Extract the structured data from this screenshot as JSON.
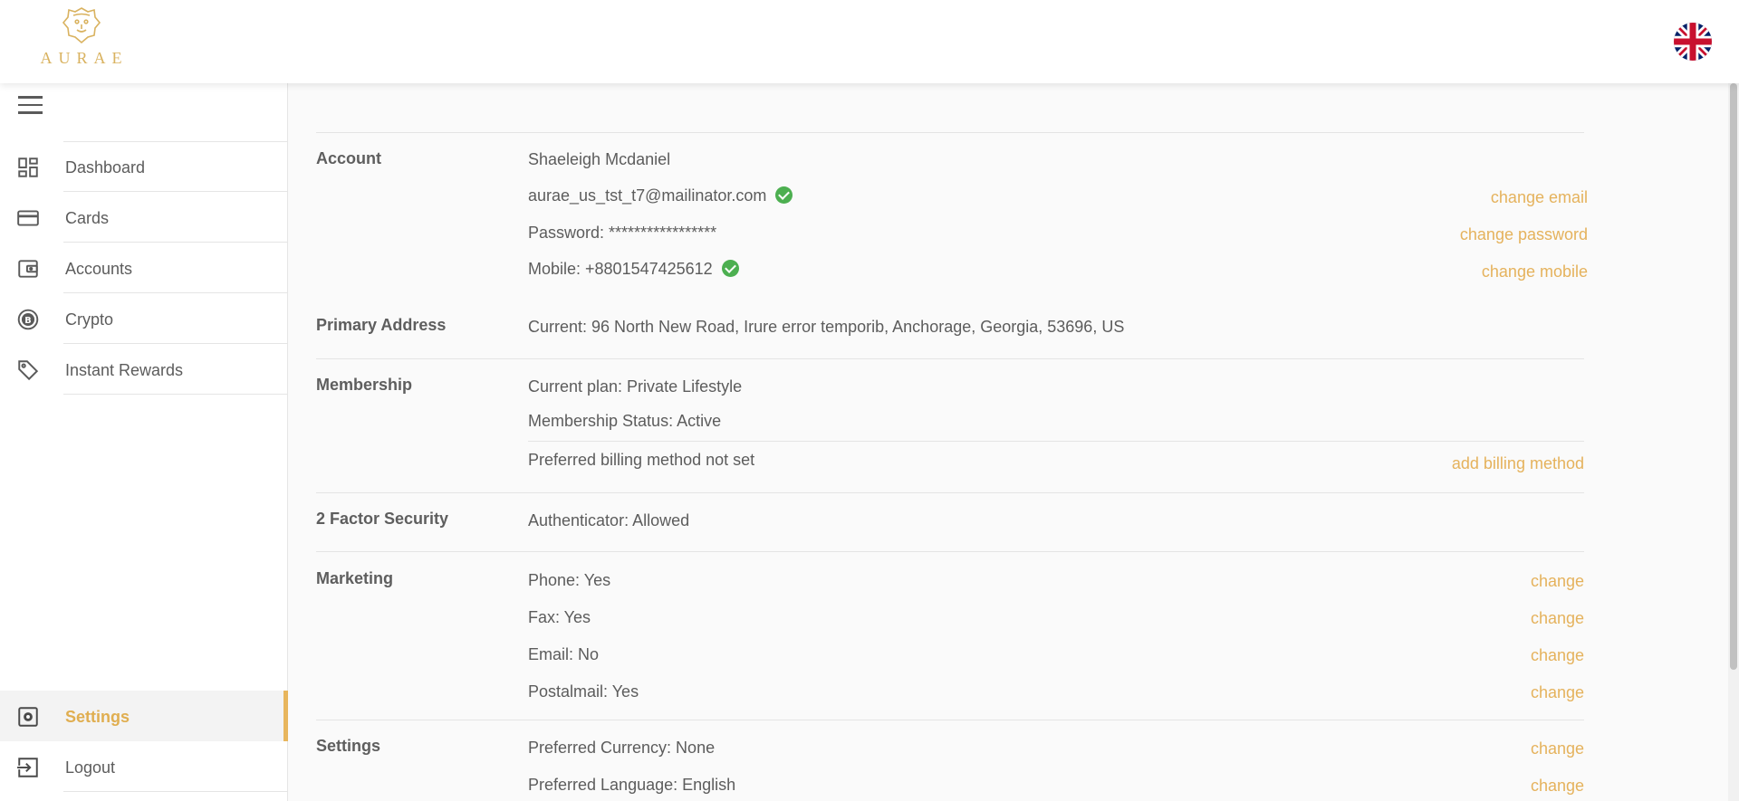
{
  "brand": {
    "name": "AURAE"
  },
  "language_flag": "united-kingdom-flag",
  "sidebar": {
    "items": [
      {
        "label": "Dashboard",
        "icon": "dashboard-icon"
      },
      {
        "label": "Cards",
        "icon": "credit-card-icon"
      },
      {
        "label": "Accounts",
        "icon": "wallet-icon"
      },
      {
        "label": "Crypto",
        "icon": "bitcoin-icon"
      },
      {
        "label": "Instant Rewards",
        "icon": "tag-icon"
      }
    ],
    "bottom_items": [
      {
        "label": "Settings",
        "icon": "settings-icon",
        "active": true
      },
      {
        "label": "Logout",
        "icon": "logout-icon"
      }
    ]
  },
  "account": {
    "title": "Account",
    "name": "Shaeleigh Mcdaniel",
    "email": "aurae_us_tst_t7@mailinator.com",
    "password": "Password: *****************",
    "mobile": "Mobile: +8801547425612",
    "change_email": "change email",
    "change_password": "change password",
    "change_mobile": "change mobile"
  },
  "primary_address": {
    "title": "Primary Address",
    "current": "Current: 96 North New Road, Irure error temporib, Anchorage, Georgia, 53696, US"
  },
  "membership": {
    "title": "Membership",
    "plan": "Current plan: Private Lifestyle",
    "status": "Membership Status: Active",
    "billing": "Preferred billing method not set",
    "add_billing": "add billing method"
  },
  "two_factor": {
    "title": "2 Factor Security",
    "authenticator": "Authenticator: Allowed"
  },
  "marketing": {
    "title": "Marketing",
    "rows": [
      {
        "label": "Phone: Yes",
        "action": "change"
      },
      {
        "label": "Fax: Yes",
        "action": "change"
      },
      {
        "label": "Email: No",
        "action": "change"
      },
      {
        "label": "Postalmail: Yes",
        "action": "change"
      }
    ]
  },
  "settings": {
    "title": "Settings",
    "rows": [
      {
        "label": "Preferred Currency: None",
        "action": "change"
      },
      {
        "label": "Preferred Language: English",
        "action": "change"
      }
    ]
  },
  "colors": {
    "accent": "#e5b25c",
    "verified": "#4caf50",
    "text": "#5c5c5c"
  }
}
